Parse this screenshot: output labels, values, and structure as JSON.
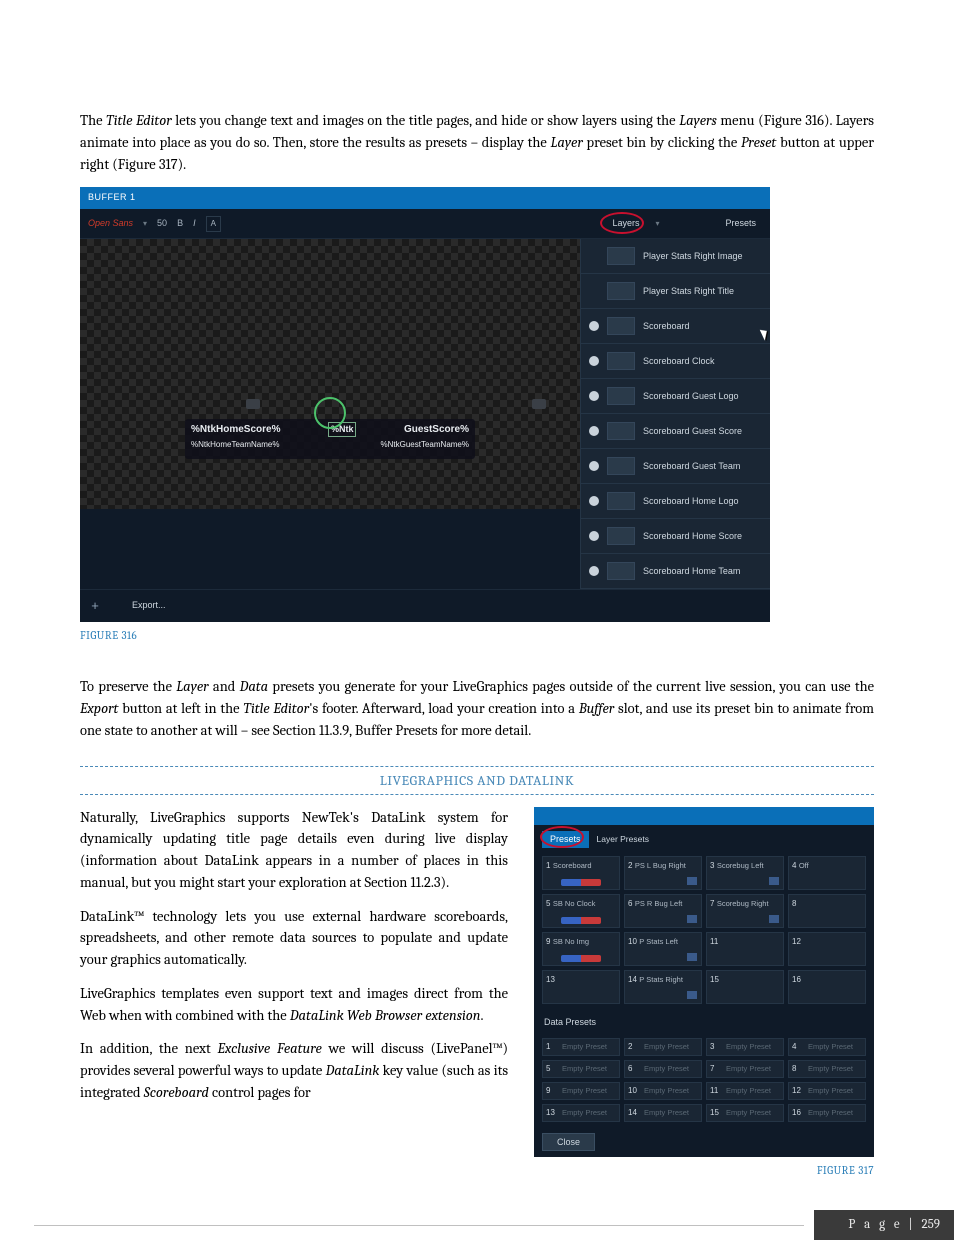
{
  "paragraphs": {
    "p1_a": "The ",
    "p1_b": "Title Editor",
    "p1_c": " lets you change text and images on the title pages, and hide or show layers using the ",
    "p1_d": "Layers",
    "p1_e": " menu (Figure 316).  Layers animate into place as you do so.  Then, store the results as presets – display the ",
    "p1_f": "Layer",
    "p1_g": " preset bin by clicking the ",
    "p1_h": "Preset",
    "p1_i": " button at upper right (Figure 317).",
    "p2_a": "To preserve the ",
    "p2_b": "Layer",
    "p2_c": " and ",
    "p2_d": "Data",
    "p2_e": " presets you generate for your LiveGraphics pages outside of the current live session, you can use the ",
    "p2_f": "Export",
    "p2_g": " button at left in the ",
    "p2_h": "Title Editor",
    "p2_i": "'s footer. Afterward, load your creation into a ",
    "p2_j": "Buffer",
    "p2_k": " slot, and use its preset bin to animate from one state to another at will – see Section 11.3.9, Buffer Presets for more detail.",
    "p3": "Naturally, LiveGraphics supports NewTek's DataLink system for dynamically updating title page details even during live display (information about DataLink appears in a number of places in this manual, but you might start your exploration at Section 11.2.3).",
    "p4": "DataLink™ technology lets you use external hardware scoreboards, spreadsheets, and other remote data sources to populate and update your graphics automatically.",
    "p5_a": "LiveGraphics templates even support text and images direct from the Web when with combined with the ",
    "p5_b": "DataLink Web Browser extension",
    "p5_c": ".",
    "p6_a": "In addition, the next ",
    "p6_b": "Exclusive Feature",
    "p6_c": " we will discuss (LivePanel™) provides several powerful ways to update ",
    "p6_d": "DataLink",
    "p6_e": " key value (such as its integrated ",
    "p6_f": "Scoreboard",
    "p6_g": " control pages for"
  },
  "section_heading": "LIVEGRAPHICS AND DATALINK",
  "captions": {
    "fig316": "FIGURE 316",
    "fig317": "FIGURE 317"
  },
  "fig316": {
    "title": "BUFFER 1",
    "font": "Open Sans",
    "size": "50",
    "bold": "B",
    "italic": "I",
    "boxA": "A",
    "layers_btn": "Layers",
    "presets_btn": "Presets",
    "overlay_score_left": "%NtkHomeScore%",
    "overlay_score_mid": "%Ntk",
    "overlay_score_right": "GuestScore%",
    "overlay_team_left": "%NtkHomeTeamName%",
    "overlay_team_right": "%NtkGuestTeamName%",
    "plus": "+",
    "export": "Export...",
    "layers": [
      "Player Stats Right Image",
      "Player Stats Right Title",
      "Scoreboard",
      "Scoreboard Clock",
      "Scoreboard Guest Logo",
      "Scoreboard Guest Score",
      "Scoreboard Guest Team",
      "Scoreboard Home Logo",
      "Scoreboard Home Score",
      "Scoreboard Home Team"
    ]
  },
  "fig317": {
    "presets_tab": "Presets",
    "layer_presets_label": "Layer Presets",
    "layer_cells": [
      {
        "n": "1",
        "l": "Scoreboard",
        "sb": true
      },
      {
        "n": "2",
        "l": "PS L Bug Right",
        "ic": true
      },
      {
        "n": "3",
        "l": "Scorebug Left",
        "ic": true
      },
      {
        "n": "4",
        "l": "Off"
      },
      {
        "n": "5",
        "l": "SB No Clock",
        "sb": true
      },
      {
        "n": "6",
        "l": "PS R Bug Left",
        "ic": true
      },
      {
        "n": "7",
        "l": "Scorebug Right",
        "ic": true
      },
      {
        "n": "8",
        "l": ""
      },
      {
        "n": "9",
        "l": "SB No Img",
        "sb": true
      },
      {
        "n": "10",
        "l": "P Stats Left",
        "ic": true
      },
      {
        "n": "11",
        "l": ""
      },
      {
        "n": "12",
        "l": ""
      },
      {
        "n": "13",
        "l": ""
      },
      {
        "n": "14",
        "l": "P Stats Right",
        "ic": true
      },
      {
        "n": "15",
        "l": ""
      },
      {
        "n": "16",
        "l": ""
      }
    ],
    "data_presets_label": "Data Presets",
    "data_cells": [
      {
        "n": "1",
        "l": "Empty Preset"
      },
      {
        "n": "2",
        "l": "Empty Preset"
      },
      {
        "n": "3",
        "l": "Empty Preset"
      },
      {
        "n": "4",
        "l": "Empty Preset"
      },
      {
        "n": "5",
        "l": "Empty Preset"
      },
      {
        "n": "6",
        "l": "Empty Preset"
      },
      {
        "n": "7",
        "l": "Empty Preset"
      },
      {
        "n": "8",
        "l": "Empty Preset"
      },
      {
        "n": "9",
        "l": "Empty Preset"
      },
      {
        "n": "10",
        "l": "Empty Preset"
      },
      {
        "n": "11",
        "l": "Empty Preset"
      },
      {
        "n": "12",
        "l": "Empty Preset"
      },
      {
        "n": "13",
        "l": "Empty Preset"
      },
      {
        "n": "14",
        "l": "Empty Preset"
      },
      {
        "n": "15",
        "l": "Empty Preset"
      },
      {
        "n": "16",
        "l": "Empty Preset"
      }
    ],
    "close": "Close"
  },
  "footer": {
    "label": "P a g e",
    "sep": " | ",
    "num": "259"
  }
}
